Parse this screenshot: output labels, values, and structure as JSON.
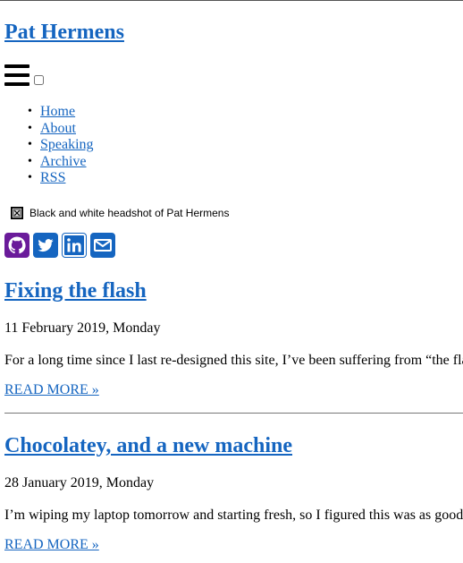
{
  "site": {
    "title": "Pat Hermens"
  },
  "nav": {
    "items": [
      {
        "label": "Home"
      },
      {
        "label": "About"
      },
      {
        "label": "Speaking"
      },
      {
        "label": "Archive"
      },
      {
        "label": "RSS"
      }
    ]
  },
  "headshot": {
    "alt": "Black and white headshot of Pat Hermens"
  },
  "social": {
    "icons": [
      "github-icon",
      "twitter-icon",
      "linkedin-icon",
      "email-icon"
    ],
    "github_color": "#6a1b9a",
    "brand_color": "#1565c0"
  },
  "posts": [
    {
      "title": "Fixing the flash",
      "date": "11 February 2019, Monday",
      "excerpt": "For a long time since I last re-designed this site, I’ve been suffering from “the flash”",
      "read_more": "READ MORE »"
    },
    {
      "title": "Chocolatey, and a new machine",
      "date": "28 January 2019, Monday",
      "excerpt": "I’m wiping my laptop tomorrow and starting fresh, so I figured this was as good a time as any",
      "read_more": "READ MORE »"
    }
  ],
  "colors": {
    "link": "#1565c0",
    "divider": "#777777"
  }
}
